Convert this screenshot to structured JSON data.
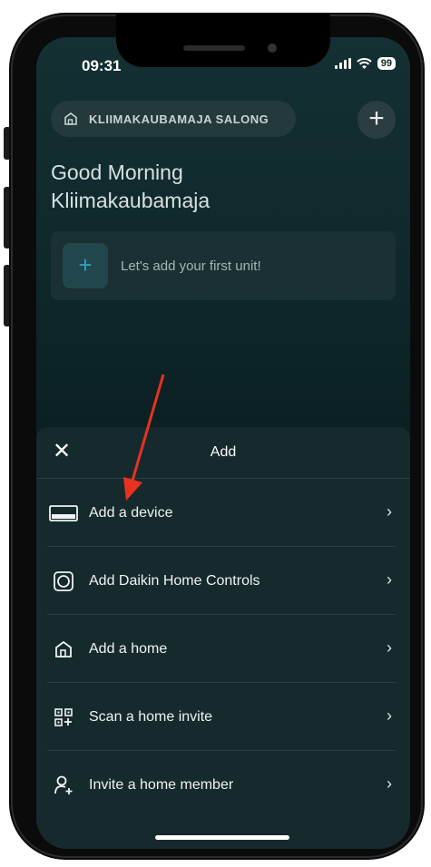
{
  "status_bar": {
    "time": "09:31",
    "battery": "99",
    "signal_icon": "signal-icon",
    "wifi_icon": "wifi-icon"
  },
  "header": {
    "home_name": "KLIIMAKAUBAMAJA SALONG",
    "home_icon": "home-icon",
    "add_label": "+"
  },
  "greeting": {
    "line1": "Good Morning",
    "line2": "Kliimakaubamaja"
  },
  "empty_state": {
    "plus": "+",
    "text": "Let's add your first unit!"
  },
  "sheet": {
    "close_label": "✕",
    "title": "Add",
    "items": [
      {
        "label": "Add a device",
        "icon": "device-icon"
      },
      {
        "label": "Add Daikin Home Controls",
        "icon": "controls-icon"
      },
      {
        "label": "Add a home",
        "icon": "home-icon"
      },
      {
        "label": "Scan a home invite",
        "icon": "qr-scan-icon"
      },
      {
        "label": "Invite a home member",
        "icon": "person-add-icon"
      }
    ],
    "chevron": "›"
  },
  "colors": {
    "sheet_bg": "#162a2d",
    "accent_blue": "#2f9ec6",
    "annotation_arrow": "#e8321f"
  }
}
